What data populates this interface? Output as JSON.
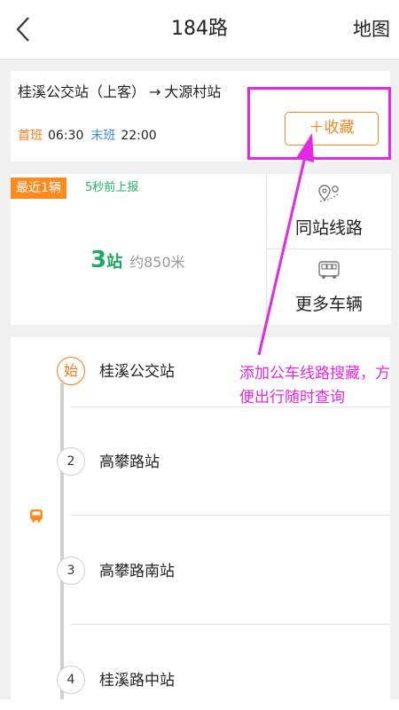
{
  "header": {
    "title": "184路",
    "map_label": "地图"
  },
  "route": {
    "from": "桂溪公交站（上客）",
    "arrow": "→",
    "to": "大源村站",
    "first_bus_label": "首班",
    "first_bus_time": "06:30",
    "last_bus_label": "末班",
    "last_bus_time": "22:00",
    "favorite_label": "＋收藏"
  },
  "status": {
    "badge": "最近1辆",
    "report_time": "5秒前上报",
    "stops_count": "3",
    "stops_unit": "站",
    "distance": "约850米"
  },
  "side": {
    "same_station_lines": "同站线路",
    "more_vehicles": "更多车辆"
  },
  "stops": [
    {
      "marker": "始",
      "name": "桂溪公交站"
    },
    {
      "marker": "2",
      "name": "高攀路站"
    },
    {
      "marker": "3",
      "name": "高攀路南站"
    },
    {
      "marker": "4",
      "name": "桂溪路中站"
    }
  ],
  "annotation": {
    "text": "添加公车线路搜藏，方便出行随时查询"
  },
  "colors": {
    "accent_orange": "#f08a24",
    "green": "#1fa864",
    "annotation_magenta": "#e628e6",
    "blue": "#3b8bd9"
  }
}
